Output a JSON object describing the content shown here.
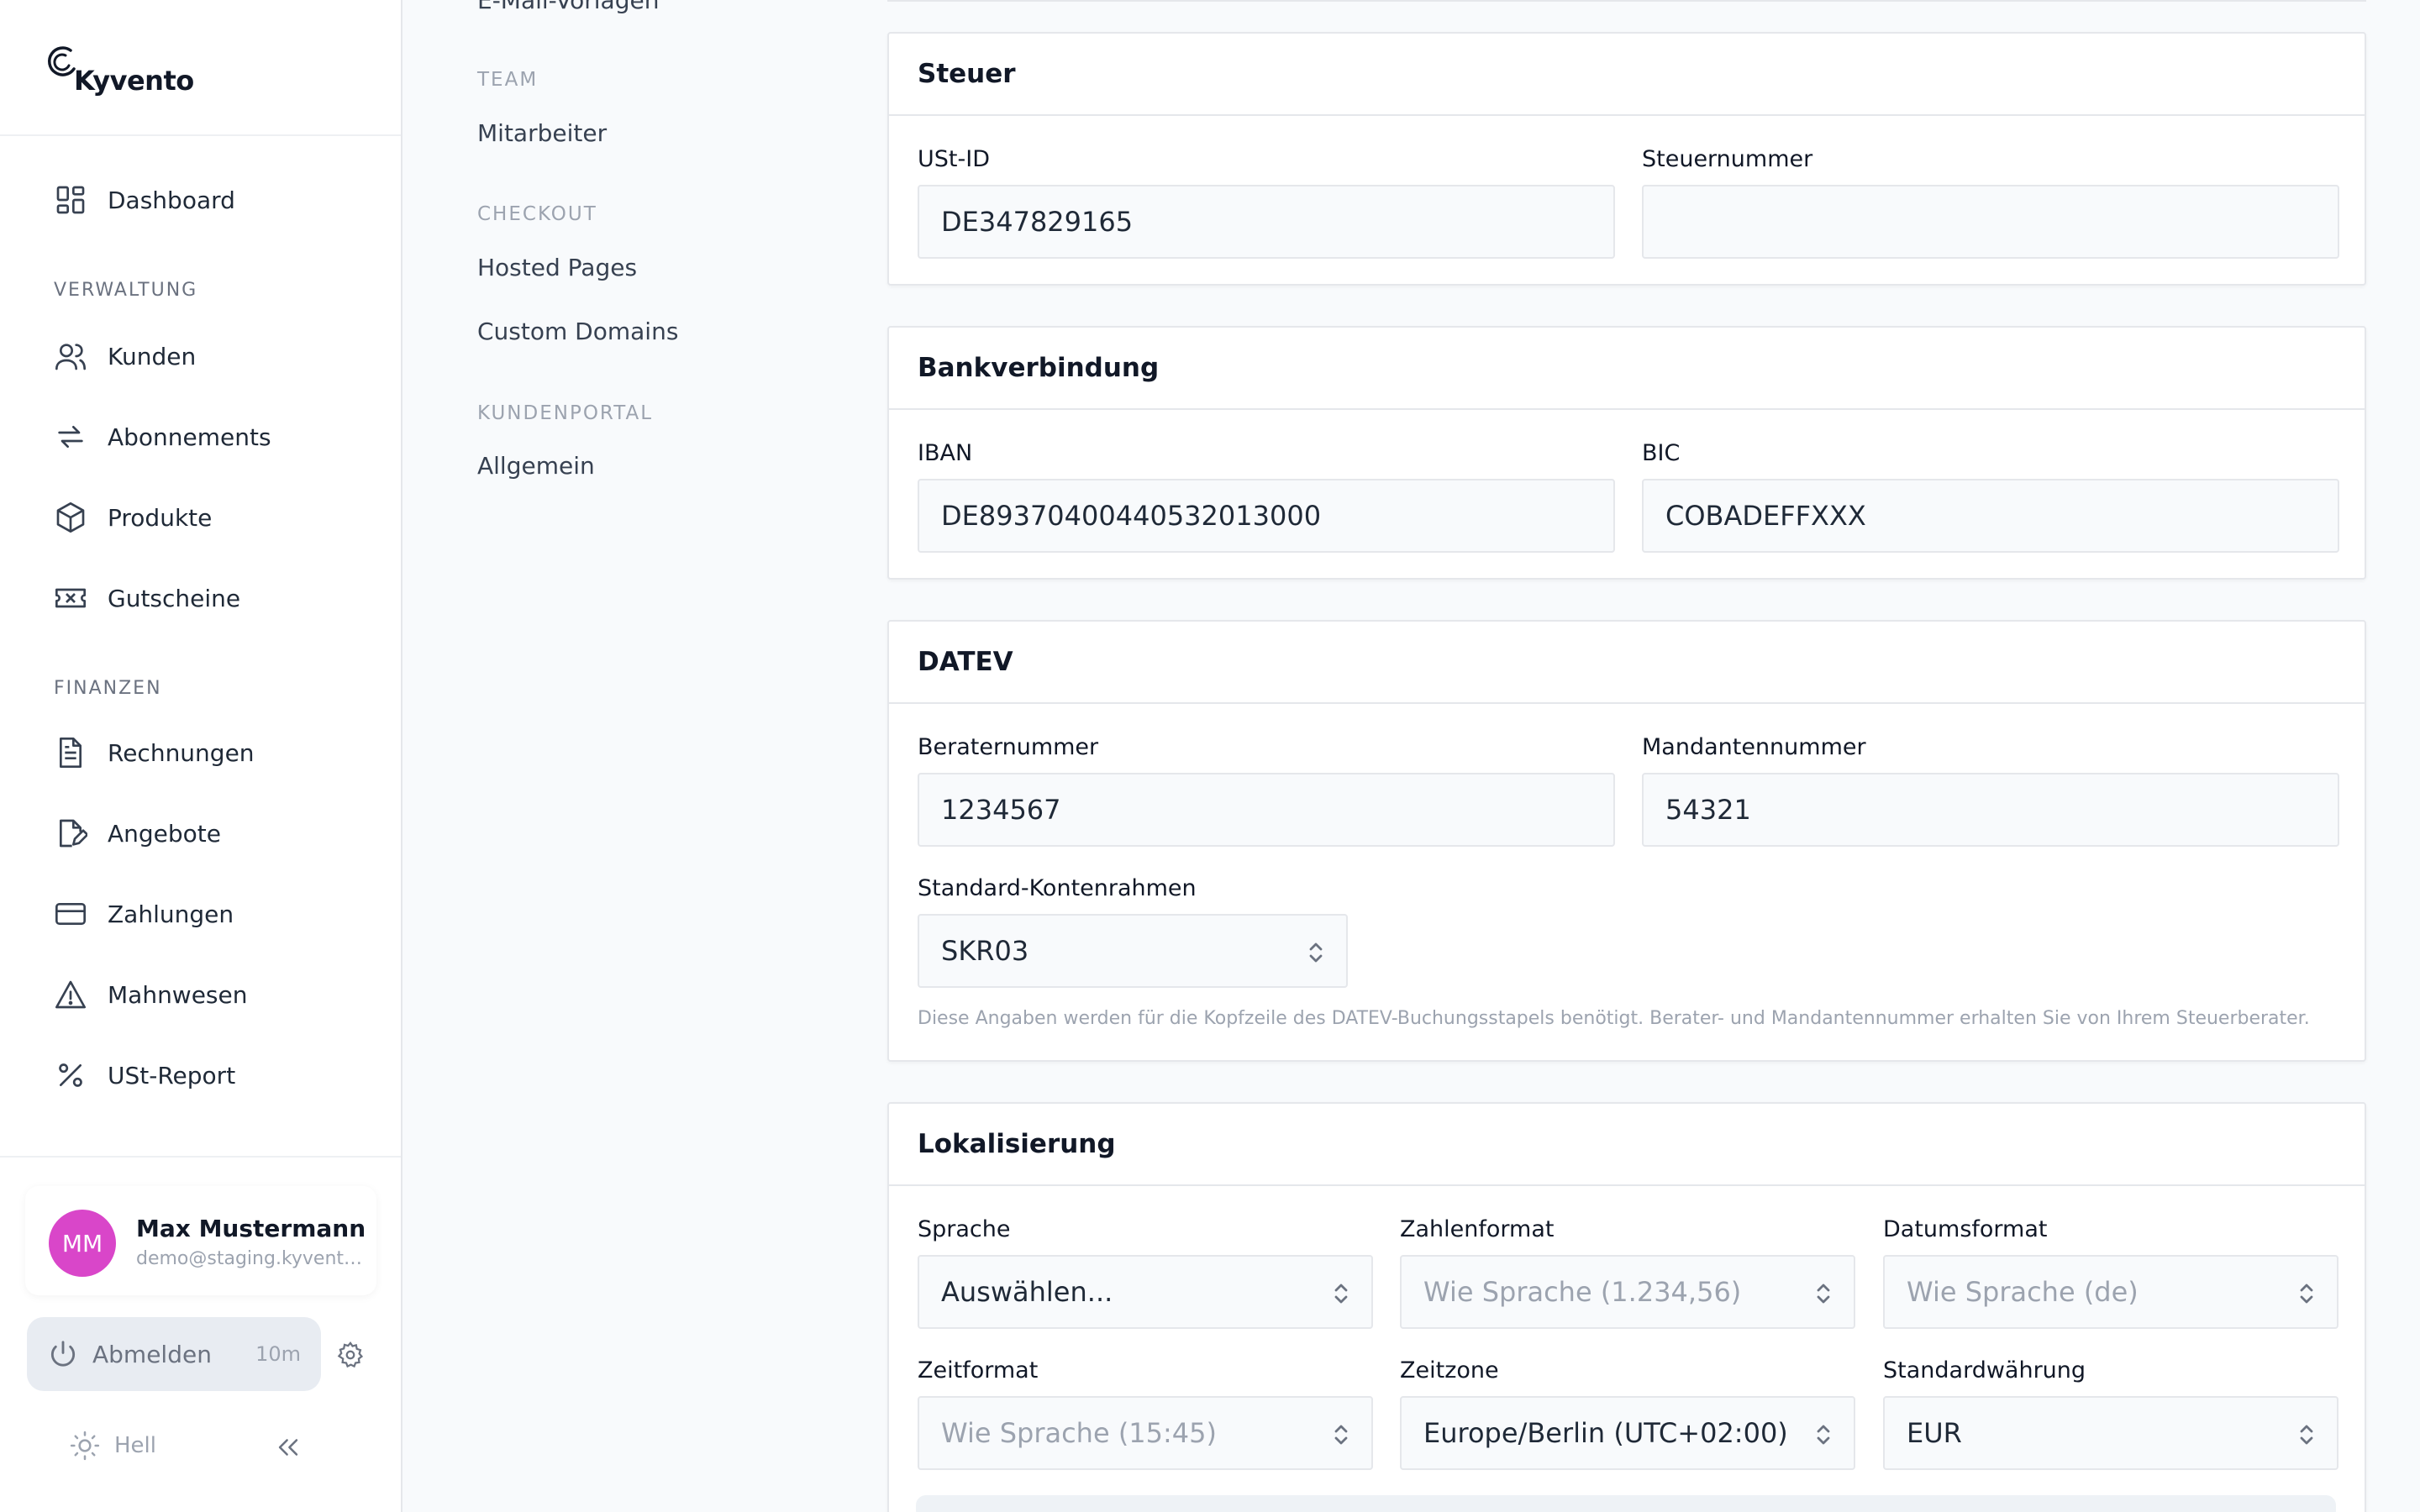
{
  "brand": {
    "name": "Kyvento"
  },
  "sidebar": {
    "dashboard": "Dashboard",
    "sections": {
      "verwaltung": "VERWALTUNG",
      "finanzen": "FINANZEN"
    },
    "items": {
      "kunden": "Kunden",
      "abonnements": "Abonnements",
      "produkte": "Produkte",
      "gutscheine": "Gutscheine",
      "rechnungen": "Rechnungen",
      "angebote": "Angebote",
      "zahlungen": "Zahlungen",
      "mahnwesen": "Mahnwesen",
      "ust_report": "USt-Report"
    },
    "user": {
      "initials": "MM",
      "name": "Max Mustermann",
      "email": "demo@staging.kyvento.de"
    },
    "logout": {
      "label": "Abmelden",
      "timer": "10m"
    },
    "theme": {
      "label": "Hell"
    }
  },
  "subnav": {
    "cut_item": "E-Mail-Vorlagen",
    "team": {
      "title": "TEAM",
      "items": [
        "Mitarbeiter"
      ]
    },
    "checkout": {
      "title": "CHECKOUT",
      "items": [
        "Hosted Pages",
        "Custom Domains"
      ]
    },
    "kundenportal": {
      "title": "KUNDENPORTAL",
      "items": [
        "Allgemein"
      ]
    }
  },
  "steuer": {
    "title": "Steuer",
    "ust_id": {
      "label": "USt-ID",
      "value": "DE347829165"
    },
    "steuernummer": {
      "label": "Steuernummer",
      "value": ""
    }
  },
  "bank": {
    "title": "Bankverbindung",
    "iban": {
      "label": "IBAN",
      "value": "DE89370400440532013000"
    },
    "bic": {
      "label": "BIC",
      "value": "COBADEFFXXX"
    }
  },
  "datev": {
    "title": "DATEV",
    "berater": {
      "label": "Beraternummer",
      "value": "1234567"
    },
    "mandant": {
      "label": "Mandantennummer",
      "value": "54321"
    },
    "kontenrahmen": {
      "label": "Standard-Kontenrahmen",
      "value": "SKR03"
    },
    "hint": "Diese Angaben werden für die Kopfzeile des DATEV-Buchungsstapels benötigt. Berater- und Mandantennummer erhalten Sie von Ihrem Steuerberater."
  },
  "lokalisierung": {
    "title": "Lokalisierung",
    "sprache": {
      "label": "Sprache",
      "value": "Auswählen..."
    },
    "zahlenformat": {
      "label": "Zahlenformat",
      "value": "Wie Sprache (1.234,56)"
    },
    "datumsformat": {
      "label": "Datumsformat",
      "value": "Wie Sprache (de)"
    },
    "zeitformat": {
      "label": "Zeitformat",
      "value": "Wie Sprache (15:45)"
    },
    "zeitzone": {
      "label": "Zeitzone",
      "value": "Europe/Berlin (UTC+02:00)"
    },
    "waehrung": {
      "label": "Standardwährung",
      "value": "EUR"
    }
  },
  "colors": {
    "avatar": "#d946c9",
    "accent": "#111827",
    "muted": "#9ca3af"
  }
}
